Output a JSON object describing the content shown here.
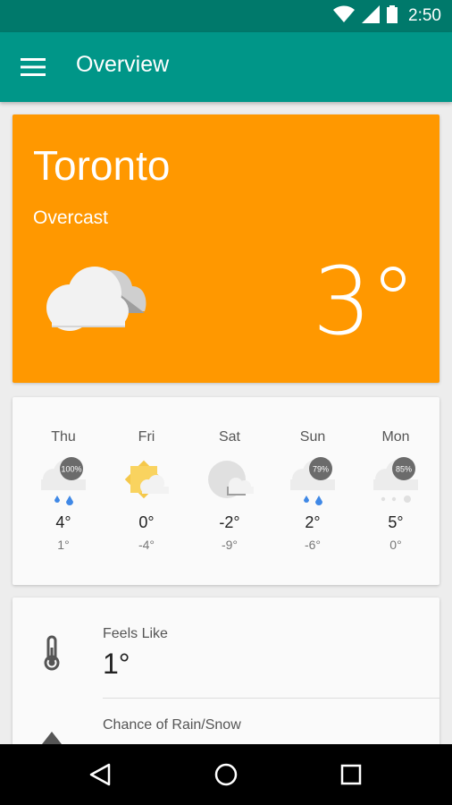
{
  "status_bar": {
    "time": "2:50",
    "icons": [
      "wifi-icon",
      "signal-icon",
      "battery-icon"
    ]
  },
  "app_bar": {
    "title": "Overview",
    "menu_icon": "menu-icon"
  },
  "current": {
    "city": "Toronto",
    "condition": "Overcast",
    "temperature": "3°",
    "icon": "overcast-icon"
  },
  "forecast": [
    {
      "day": "Thu",
      "icon": "rain-icon",
      "precip": "100%",
      "high": "4°",
      "low": "1°"
    },
    {
      "day": "Fri",
      "icon": "partly-sunny-icon",
      "precip": "",
      "high": "0°",
      "low": "-4°"
    },
    {
      "day": "Sat",
      "icon": "partly-cloudy-night-icon",
      "precip": "",
      "high": "-2°",
      "low": "-9°"
    },
    {
      "day": "Sun",
      "icon": "rain-icon",
      "precip": "79%",
      "high": "2°",
      "low": "-6°"
    },
    {
      "day": "Mon",
      "icon": "snow-icon",
      "precip": "85%",
      "high": "5°",
      "low": "0°"
    }
  ],
  "details": {
    "feels_like": {
      "label": "Feels Like",
      "value": "1°",
      "icon": "thermometer-icon"
    },
    "precip": {
      "label": "Chance of Rain/Snow",
      "icon": "raindrop-icon"
    }
  },
  "nav_bar": {
    "icons": [
      "back-icon",
      "home-icon",
      "recents-icon"
    ]
  },
  "colors": {
    "status_bar": "#00796b",
    "app_bar": "#009688",
    "hero": "#ff9800",
    "rain": "#3f88e6"
  }
}
